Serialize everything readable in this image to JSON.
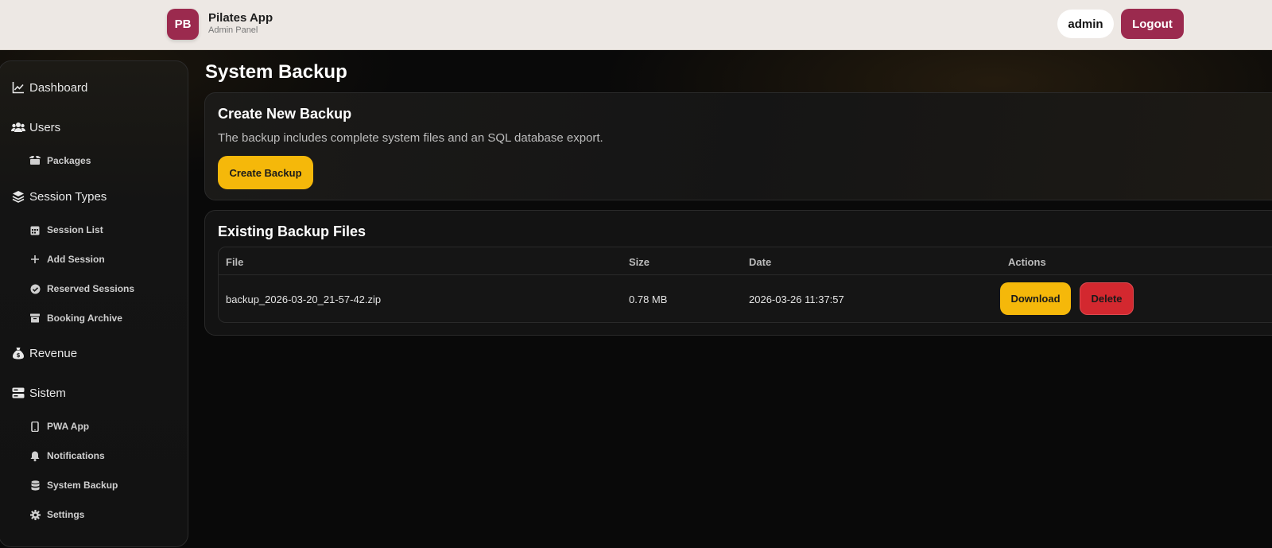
{
  "header": {
    "logo_initials": "PB",
    "app_name": "Pilates App",
    "app_subtitle": "Admin Panel",
    "username": "admin",
    "logout_label": "Logout"
  },
  "sidebar": {
    "items": [
      {
        "label": "Dashboard",
        "icon": "chart-line-icon",
        "level": "main"
      },
      {
        "label": "Users",
        "icon": "users-icon",
        "level": "main"
      },
      {
        "label": "Packages",
        "icon": "box-icon",
        "level": "sub"
      },
      {
        "label": "Session Types",
        "icon": "layers-icon",
        "level": "main"
      },
      {
        "label": "Session List",
        "icon": "calendar-icon",
        "level": "sub"
      },
      {
        "label": "Add Session",
        "icon": "plus-icon",
        "level": "sub"
      },
      {
        "label": "Reserved Sessions",
        "icon": "check-circle-icon",
        "level": "sub"
      },
      {
        "label": "Booking Archive",
        "icon": "archive-icon",
        "level": "sub"
      },
      {
        "label": "Revenue",
        "icon": "money-bag-icon",
        "level": "main"
      },
      {
        "label": "Sistem",
        "icon": "server-icon",
        "level": "main"
      },
      {
        "label": "PWA App",
        "icon": "mobile-icon",
        "level": "sub"
      },
      {
        "label": "Notifications",
        "icon": "bell-icon",
        "level": "sub"
      },
      {
        "label": "System Backup",
        "icon": "database-icon",
        "level": "sub",
        "active": true
      },
      {
        "label": "Settings",
        "icon": "gear-icon",
        "level": "sub"
      }
    ]
  },
  "main": {
    "page_title": "System Backup",
    "create_card": {
      "title": "Create New Backup",
      "description": "The backup includes complete system files and an SQL database export.",
      "button_label": "Create Backup"
    },
    "files_card": {
      "title": "Existing Backup Files",
      "columns": [
        "File",
        "Size",
        "Date",
        "Actions"
      ],
      "rows": [
        {
          "file": "backup_2026-03-20_21-57-42.zip",
          "size": "0.78 MB",
          "date": "2026-03-26 11:37:57",
          "download_label": "Download",
          "delete_label": "Delete"
        }
      ]
    }
  },
  "colors": {
    "brand": "#9b2a4e",
    "accent": "#f5b80a",
    "danger": "#d3282f",
    "topbar": "#ede8e4"
  }
}
